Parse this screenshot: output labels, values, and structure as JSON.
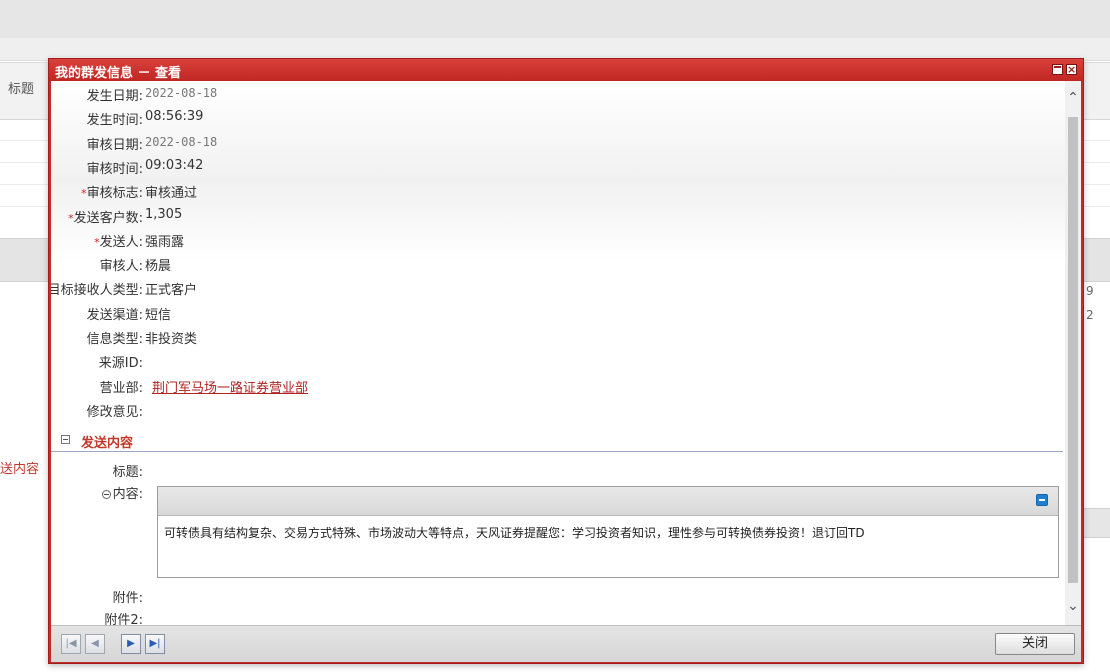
{
  "background": {
    "column_title": "标题",
    "left_label": "送内容",
    "right_digits": [
      "9",
      "2"
    ]
  },
  "dialog": {
    "title": "我的群发信息 － 查看",
    "fields": [
      {
        "label": "发生日期",
        "value": "2022-08-18",
        "required": false,
        "kind": "date"
      },
      {
        "label": "发生时间",
        "value": "08:56:39",
        "required": false,
        "kind": "text"
      },
      {
        "label": "审核日期",
        "value": "2022-08-18",
        "required": false,
        "kind": "date"
      },
      {
        "label": "审核时间",
        "value": "09:03:42",
        "required": false,
        "kind": "text"
      },
      {
        "label": "审核标志",
        "value": "审核通过",
        "required": true,
        "kind": "text"
      },
      {
        "label": "发送客户数",
        "value": "1,305",
        "required": true,
        "kind": "text"
      },
      {
        "label": "发送人",
        "value": "强雨露",
        "required": true,
        "kind": "text"
      },
      {
        "label": "审核人",
        "value": "杨晨",
        "required": false,
        "kind": "text"
      },
      {
        "label": "目标接收人类型",
        "value": "正式客户",
        "required": false,
        "kind": "text"
      },
      {
        "label": "发送渠道",
        "value": "短信",
        "required": false,
        "kind": "text"
      },
      {
        "label": "信息类型",
        "value": "非投资类",
        "required": false,
        "kind": "text"
      },
      {
        "label": "来源ID",
        "value": "",
        "required": false,
        "kind": "text"
      },
      {
        "label": "营业部",
        "value": "荆门军马场一路证券营业部",
        "required": false,
        "kind": "link"
      },
      {
        "label": "修改意见",
        "value": "",
        "required": false,
        "kind": "text"
      }
    ],
    "section_title": "发送内容",
    "subject_label": "标题",
    "content_label": "内容",
    "content_text": "可转债具有结构复杂、交易方式特殊、市场波动大等特点，天风证券提醒您：学习投资者知识，理性参与可转换债券投资！退订回TD",
    "attachment_label": "附件",
    "attachment2_label": "附件2",
    "close_label": "关闭"
  }
}
